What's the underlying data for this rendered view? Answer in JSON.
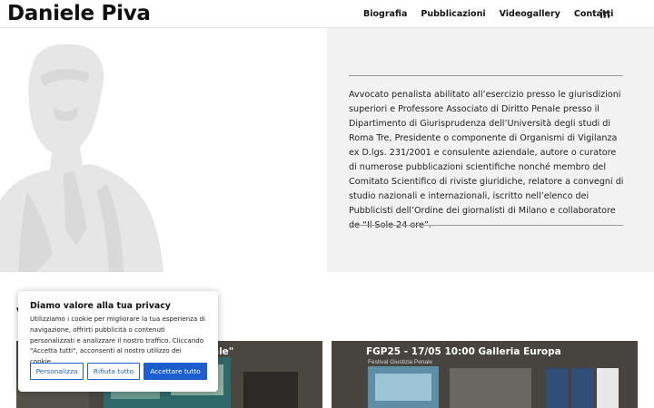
{
  "header": {
    "brand": "Daniele Piva",
    "nav": [
      "Biografia",
      "Pubblicazioni",
      "Videogallery",
      "Contatti"
    ],
    "social_icon": "linkedin-icon"
  },
  "hero": {
    "bio": "Avvocato penalista abilitato all’esercizio presso le giurisdizioni superiori e Professore Associato di Diritto Penale presso il Dipartimento di Giurisprudenza dell’Università degli studi di Roma Tre, Presidente o componente di Organismi di Vigilanza ex D.lgs. 231/2001 e consulente aziendale, autore o curatore di numerose pubblicazioni scientifiche nonché membro del Comitato Scientifico di riviste giuridiche, relatore a convegni di studio nazionali e internazionali, iscritto nell’elenco dei Pubblicisti dell’Ordine dei giornalisti di Milano e collaboratore de “Il Sole 24 ore”."
  },
  "section": {
    "heading_fragment": "V"
  },
  "videos": [
    {
      "title": "ale\"",
      "subtitle": ""
    },
    {
      "title": "FGP25 - 17/05 10:00 Galleria Europa",
      "subtitle": "Festival Giustizia Penale"
    }
  ],
  "cookie": {
    "title": "Diamo valore alla tua privacy",
    "text": "Utilizziamo i cookie per migliorare la tua esperienza di navigazione, offrirti pubblicità o contenuti personalizzati e analizzare il nostro traffico. Cliccando \"Accetta tutti\", acconsenti al nostro utilizzo dei cookie.",
    "buttons": {
      "customize": "Personalizza",
      "reject": "Rifiuta tutto",
      "accept": "Accettare tutto"
    }
  },
  "colors": {
    "accent": "#1e5fd0",
    "hero_panel": "#f2f2f2",
    "silhouette": "#e4e4e4"
  }
}
